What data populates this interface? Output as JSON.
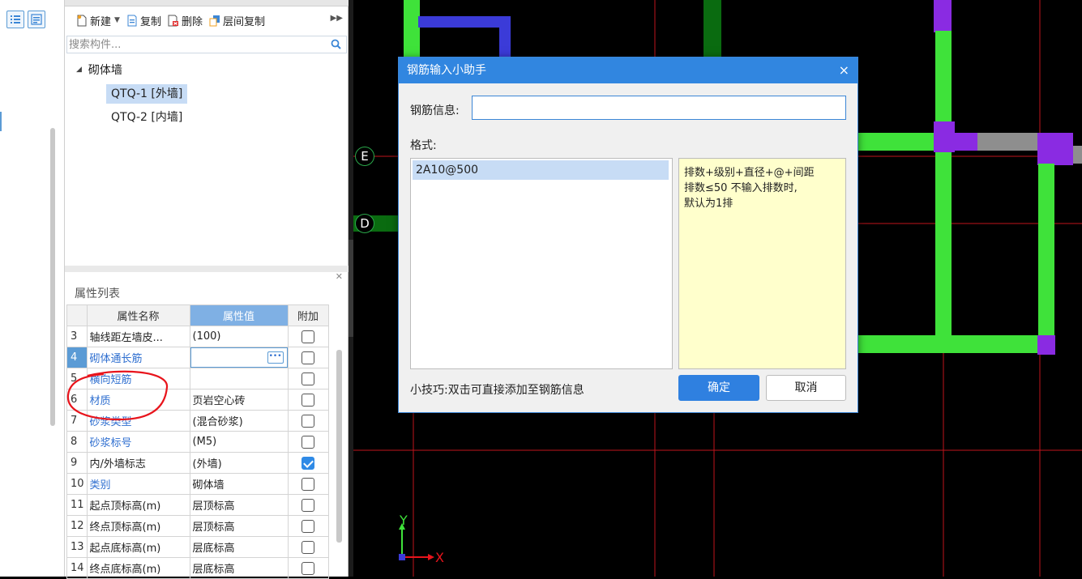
{
  "component_panel": {
    "toolbar": {
      "new_label": "新建",
      "copy_label": "复制",
      "delete_label": "删除",
      "floor_copy_label": "层间复制"
    },
    "search_placeholder": "搜索构件...",
    "tree": {
      "root": "砌体墙",
      "items": [
        "QTQ-1 [外墙]",
        "QTQ-2 [内墙]"
      ]
    }
  },
  "property_panel": {
    "title": "属性列表",
    "headers": {
      "name": "属性名称",
      "value": "属性值",
      "extra": "附加"
    },
    "rows": [
      {
        "num": "3",
        "name": "轴线距左墙皮...",
        "value": "(100)",
        "checked": false
      },
      {
        "num": "4",
        "name": "砌体通长筋",
        "value": "",
        "checked": false
      },
      {
        "num": "5",
        "name": "横向短筋",
        "value": "",
        "checked": false
      },
      {
        "num": "6",
        "name": "材质",
        "value": "页岩空心砖",
        "checked": false
      },
      {
        "num": "7",
        "name": "砂浆类型",
        "value": "(混合砂浆)",
        "checked": false
      },
      {
        "num": "8",
        "name": "砂浆标号",
        "value": "(M5)",
        "checked": false
      },
      {
        "num": "9",
        "name": "内/外墙标志",
        "value": "(外墙)",
        "checked": true
      },
      {
        "num": "10",
        "name": "类别",
        "value": "砌体墙",
        "checked": false
      },
      {
        "num": "11",
        "name": "起点顶标高(m)",
        "value": "层顶标高",
        "checked": false
      },
      {
        "num": "12",
        "name": "终点顶标高(m)",
        "value": "层顶标高",
        "checked": false
      },
      {
        "num": "13",
        "name": "起点底标高(m)",
        "value": "层底标高",
        "checked": false
      },
      {
        "num": "14",
        "name": "终点底标高(m)",
        "value": "层底标高",
        "checked": false
      }
    ]
  },
  "cad": {
    "axis_e": "E",
    "axis_d": "D",
    "coord_x": "X",
    "coord_y": "Y"
  },
  "dialog": {
    "title": "钢筋输入小助手",
    "close": "×",
    "info_label": "钢筋信息:",
    "info_value": "",
    "format_label": "格式:",
    "format_items": [
      "2A10@500"
    ],
    "help_lines": [
      "排数+级别+直径+@+间距",
      "排数≤50    不输入排数时,",
      "默认为1排"
    ],
    "tip": "小技巧:双击可直接添加至钢筋信息",
    "ok_label": "确定",
    "cancel_label": "取消"
  },
  "colors": {
    "accent": "#3186e0",
    "wall_green": "#3fe23a",
    "wall_purple": "#8a2be2",
    "grid_red": "#c0141c",
    "annotation_red": "#e8141c"
  }
}
